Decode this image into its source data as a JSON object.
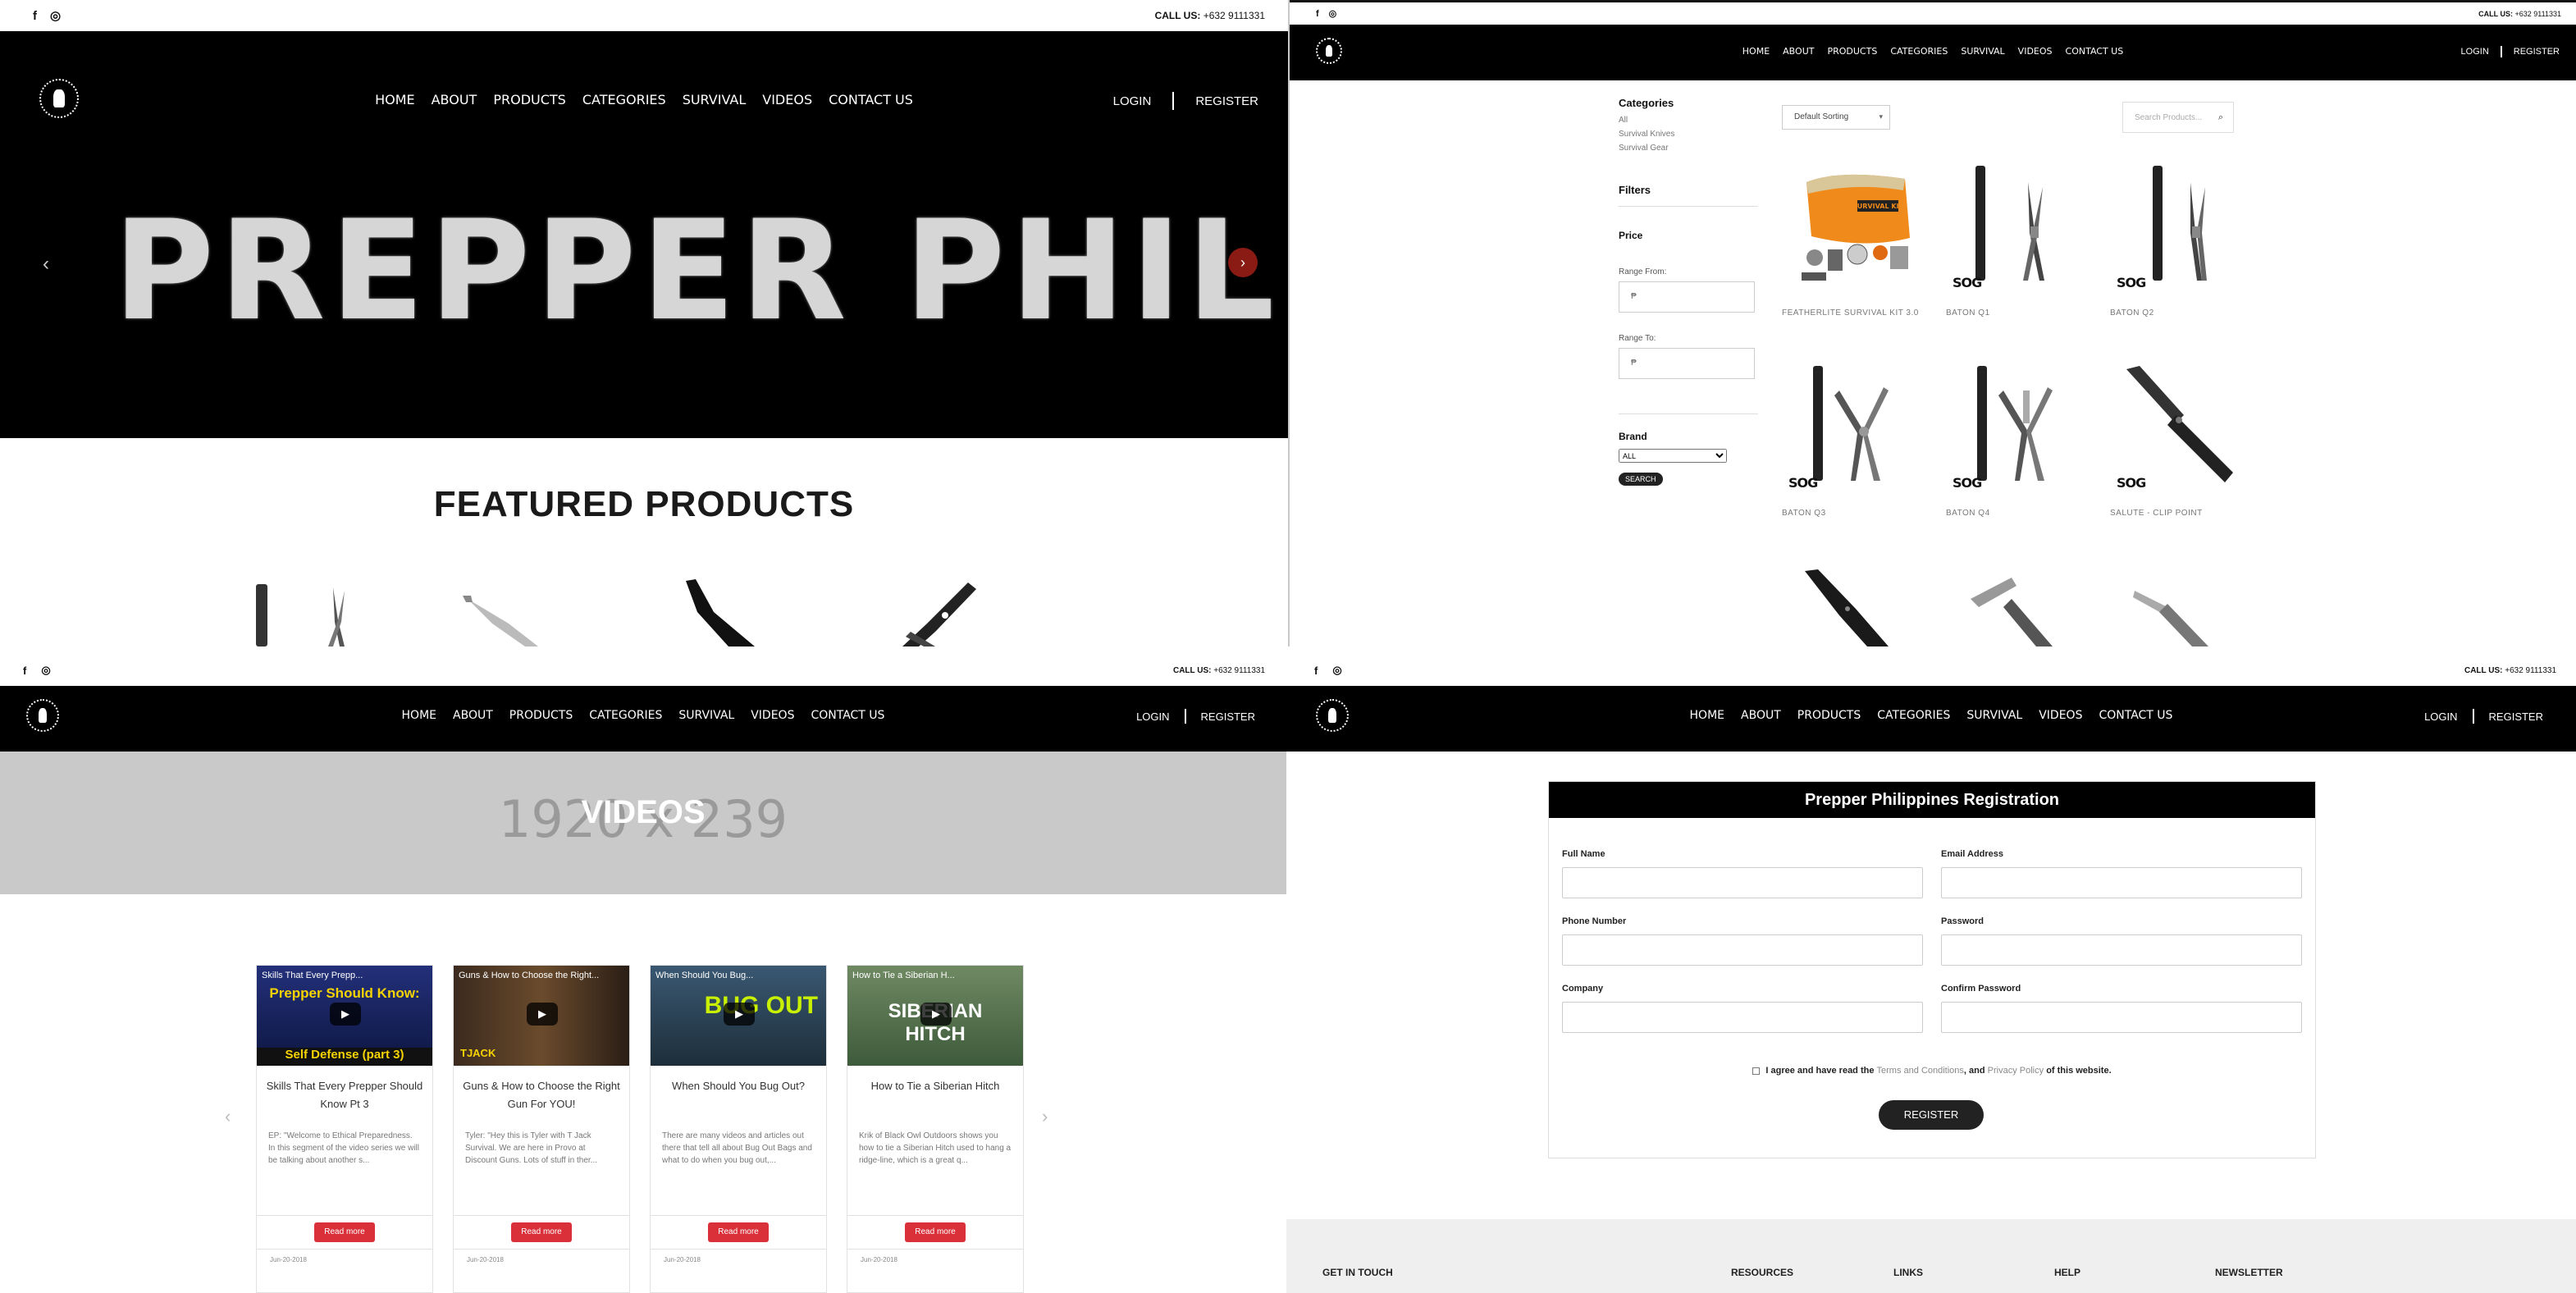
{
  "site": {
    "call_label": "CALL US:",
    "phone": "+632 9111331",
    "nav": [
      "HOME",
      "ABOUT",
      "PRODUCTS",
      "CATEGORIES",
      "SURVIVAL",
      "VIDEOS",
      "CONTACT US"
    ],
    "login": "LOGIN",
    "register": "REGISTER",
    "facebook_icon": "facebook-icon",
    "instagram_icon": "instagram-icon"
  },
  "home": {
    "hero_title": "PREPPER PHILIPPINES",
    "prev_icon": "chevron-left-icon",
    "next_icon": "chevron-right-icon",
    "featured_heading": "FEATURED PRODUCTS"
  },
  "shop": {
    "categories_heading": "Categories",
    "categories": [
      "All",
      "Survival Knives",
      "Survival Gear"
    ],
    "filters_heading": "Filters",
    "price_heading": "Price",
    "range_from_label": "Range From:",
    "range_from_value": "₱",
    "range_to_label": "Range To:",
    "range_to_value": "₱",
    "brand_heading": "Brand",
    "brand_selected": "ALL",
    "search_button": "SEARCH",
    "sort_selected": "Default Sorting",
    "search_placeholder": "Search Products...",
    "products": [
      {
        "name": "FEATHERLITE SURVIVAL KIT 3.0",
        "brand": ""
      },
      {
        "name": "BATON Q1",
        "brand": "SOG"
      },
      {
        "name": "BATON Q2",
        "brand": "SOG"
      },
      {
        "name": "BATON Q3",
        "brand": "SOG"
      },
      {
        "name": "BATON Q4",
        "brand": "SOG"
      },
      {
        "name": "SALUTE - CLIP POINT",
        "brand": "SOG"
      }
    ],
    "kit_label": "SURVIVAL KIT"
  },
  "videos": {
    "banner_placeholder": "1920 x 239",
    "banner_title": "VIDEOS",
    "cards": [
      {
        "thumb_title": "Skills That Every Prepp...",
        "thumb_text": "Prepper Should Know:",
        "thumb_sub": "Self Defense (part 3)",
        "title": "Skills That Every Prepper Should Know Pt 3",
        "desc": "EP: \"Welcome to Ethical Preparedness. In this segment of the video series we will be talking about another s...",
        "button": "Read more",
        "date": "Jun-20-2018"
      },
      {
        "thumb_title": "Guns & How to Choose the Right...",
        "thumb_text": "",
        "thumb_sub": "TJACK",
        "title": "Guns & How to Choose the Right Gun For YOU!",
        "desc": "Tyler: \"Hey this is Tyler with T Jack Survival. We are here in Provo at Discount Guns. Lots of stuff in ther...",
        "button": "Read more",
        "date": "Jun-20-2018"
      },
      {
        "thumb_title": "When Should You Bug...",
        "thumb_text": "BUG OUT",
        "thumb_sub": "",
        "title": "When Should You Bug Out?",
        "desc": "There are many videos and articles out there that tell all about Bug Out Bags and what to do when you bug out,...",
        "button": "Read more",
        "date": "Jun-20-2018"
      },
      {
        "thumb_title": "How to Tie a Siberian H...",
        "thumb_text": "SIBERIAN HITCH",
        "thumb_sub": "",
        "title": "How to Tie a Siberian Hitch",
        "desc": "Krik of Black Owl Outdoors shows you how to tie a Siberian Hitch used to hang a ridge-line, which is a great q...",
        "button": "Read more",
        "date": "Jun-20-2018"
      }
    ]
  },
  "registration": {
    "heading": "Prepper Philippines Registration",
    "fields": [
      "Full Name",
      "Email Address",
      "Phone Number",
      "Password",
      "Company",
      "Confirm Password"
    ],
    "agree_prefix": "I agree and have read the",
    "terms_link": "Terms and Conditions",
    "agree_mid": ", and",
    "privacy_link": "Privacy Policy",
    "agree_suffix": "of this website.",
    "button": "REGISTER"
  },
  "footer": {
    "columns": [
      "GET IN TOUCH",
      "RESOURCES",
      "LINKS",
      "HELP",
      "NEWSLETTER"
    ]
  }
}
